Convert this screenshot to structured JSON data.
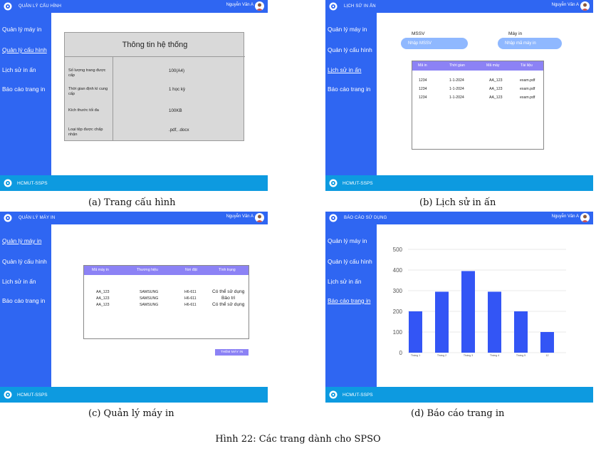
{
  "user_name": "Nguyễn Văn A",
  "app_name": "HCMUT-SSPS",
  "sidebar": {
    "items": [
      "Quản lý máy in",
      "Quản lý cấu hình",
      "Lịch sử in ấn",
      "Báo cáo trang in"
    ]
  },
  "panel_a": {
    "header_title": "QUẢN LÝ CẤU HÌNH",
    "card_title": "Thông tin hệ thống",
    "rows": [
      {
        "label": "Số lượng trang được cấp",
        "value": "100(A4)"
      },
      {
        "label": "Thời gian định kì cung cấp",
        "value": "1 học kỳ"
      },
      {
        "label": "Kích thước tối đa",
        "value": "100KB"
      },
      {
        "label": "Loại tệp được chấp nhận",
        "value": ".pdf, .docx"
      }
    ],
    "caption": "(a) Trang cấu hình"
  },
  "panel_b": {
    "header_title": "LỊCH SỬ IN ẤN",
    "mssv_label": "MSSV",
    "mssv_placeholder": "Nhập MSSV",
    "printer_label": "Máy in",
    "printer_placeholder": "Nhập mã máy in",
    "columns": [
      "Mã in",
      "Thời gian",
      "Mã máy",
      "Tài liệu"
    ],
    "rows": [
      [
        "1234",
        "1-1-2024",
        "AA_123",
        "exam.pdf"
      ],
      [
        "1234",
        "1-1-2024",
        "AA_123",
        "exam.pdf"
      ],
      [
        "1234",
        "1-1-2024",
        "AA_123",
        "exam.pdf"
      ]
    ],
    "caption": "(b) Lịch sử in ấn"
  },
  "panel_c": {
    "header_title": "QUẢN LÝ MÁY IN",
    "columns": [
      "Mã máy in",
      "Thương hiệu",
      "Nơi đặt",
      "Tình trạng"
    ],
    "rows": [
      [
        "AA_123",
        "SAMSUNG",
        "H6-611",
        "Có thể sử dụng"
      ],
      [
        "AA_123",
        "SAMSUNG",
        "H6-611",
        "Bảo trì"
      ],
      [
        "AA_123",
        "SAMSUNG",
        "H6-611",
        "Có thể sử dụng"
      ]
    ],
    "add_button": "THÊM MÁY IN",
    "caption": "(c) Quản lý máy in"
  },
  "panel_d": {
    "header_title": "BÁO CÁO SỬ DỤNG",
    "caption": "(d) Báo cáo trang in"
  },
  "chart_data": {
    "type": "bar",
    "categories": [
      "Tháng 1",
      "Tháng 2",
      "Tháng 3",
      "Tháng 4",
      "Tháng 5",
      "12"
    ],
    "values": [
      200,
      295,
      395,
      295,
      200,
      100
    ],
    "ylim": [
      0,
      500
    ],
    "yticks": [
      0,
      100,
      200,
      300,
      400,
      500
    ],
    "bar_color": "#3355f5",
    "grid": true
  },
  "figure_caption": "Hình 22: Các trang dành cho SPSO",
  "colors": {
    "primary": "#2f66f2",
    "footer": "#0d9ae0",
    "accent": "#8c82f5"
  }
}
